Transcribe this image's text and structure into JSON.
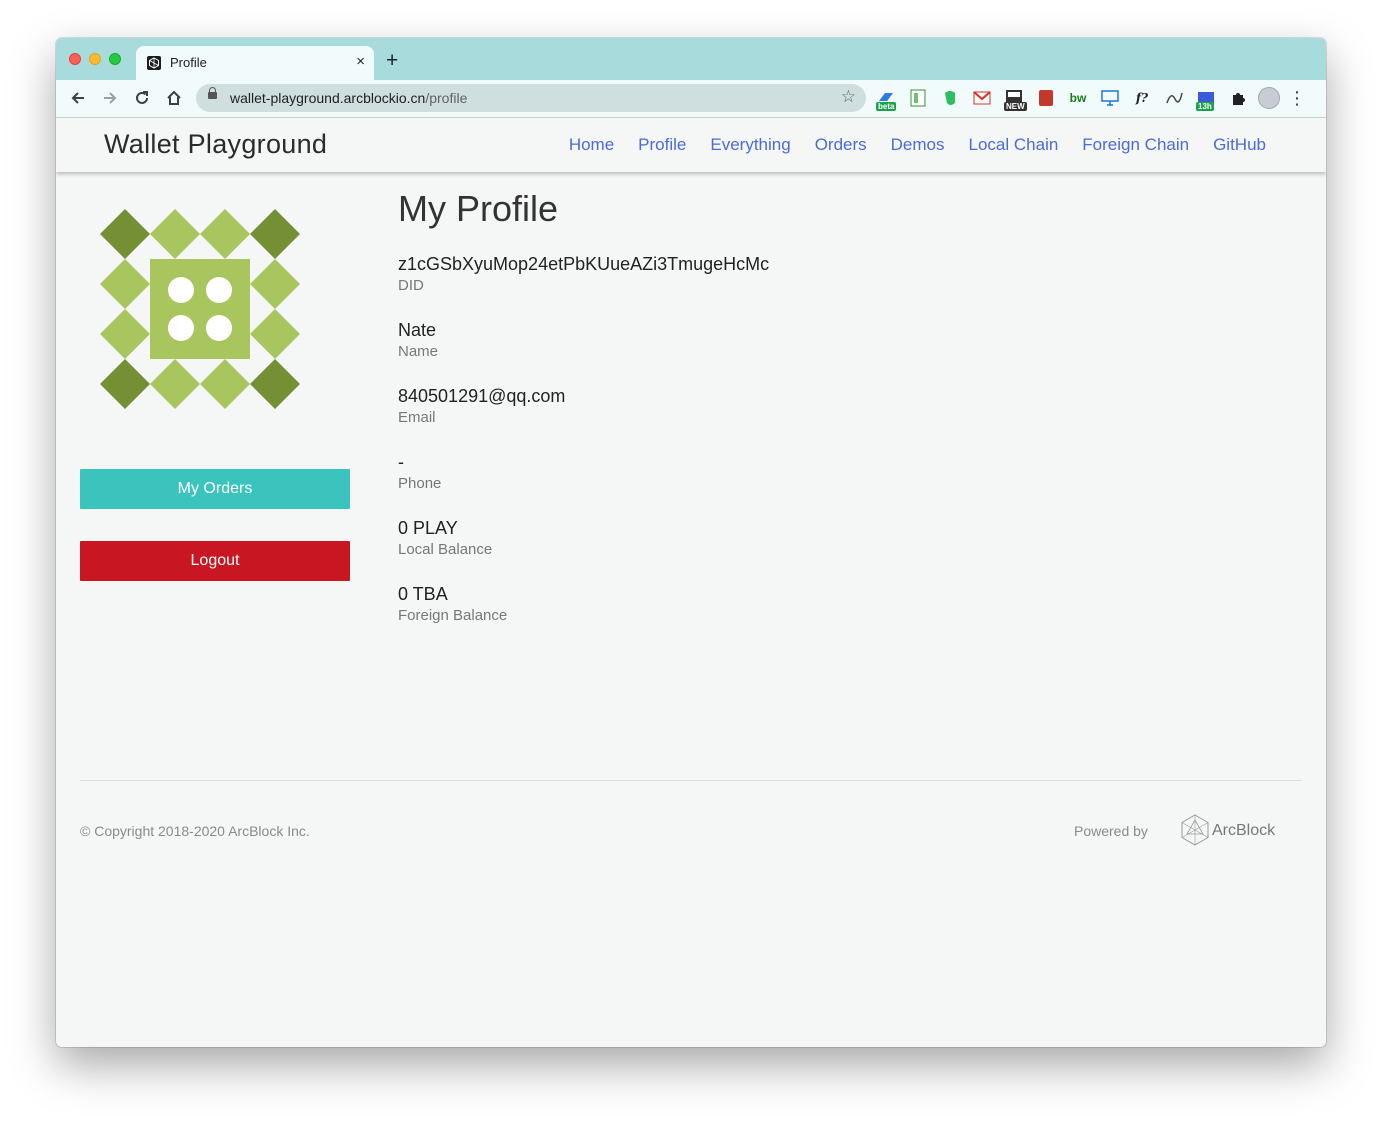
{
  "browser": {
    "tab_title": "Profile",
    "tab_close": "×",
    "new_tab": "+",
    "url_host": "wallet-playground.arcblockio.cn",
    "url_path": "/profile",
    "extensions": [
      {
        "name": "beta-ext",
        "badge": "beta"
      },
      {
        "name": "sheet-ext"
      },
      {
        "name": "evernote-ext"
      },
      {
        "name": "gmail-ext"
      },
      {
        "name": "news-ext",
        "badge": "NEW"
      },
      {
        "name": "red-ext"
      },
      {
        "name": "bw-ext",
        "text": "bw"
      },
      {
        "name": "screen-ext"
      },
      {
        "name": "fx-ext",
        "text": "f?"
      },
      {
        "name": "translate-ext"
      },
      {
        "name": "calendar-ext",
        "badge": "13h"
      },
      {
        "name": "puzzle-ext"
      }
    ]
  },
  "app": {
    "brand": "Wallet Playground",
    "nav": [
      "Home",
      "Profile",
      "Everything",
      "Orders",
      "Demos",
      "Local Chain",
      "Foreign Chain",
      "GitHub"
    ]
  },
  "sidebar": {
    "orders_button": "My Orders",
    "logout_button": "Logout",
    "colors": {
      "orders": "#3bc4be",
      "logout": "#c81622",
      "identicon_light": "#a8c55e",
      "identicon_dark": "#748f34"
    }
  },
  "profile": {
    "title": "My Profile",
    "fields": [
      {
        "value": "z1cGSbXyuMop24etPbKUueAZi3TmugeHcMc",
        "label": "DID"
      },
      {
        "value": "Nate",
        "label": "Name"
      },
      {
        "value": "840501291@qq.com",
        "label": "Email"
      },
      {
        "value": "-",
        "label": "Phone"
      },
      {
        "value": "0 PLAY",
        "label": "Local Balance"
      },
      {
        "value": "0 TBA",
        "label": "Foreign Balance"
      }
    ]
  },
  "footer": {
    "copyright": "© Copyright 2018-2020  ArcBlock Inc.",
    "powered_by": "Powered by",
    "brand": "ArcBlock"
  }
}
